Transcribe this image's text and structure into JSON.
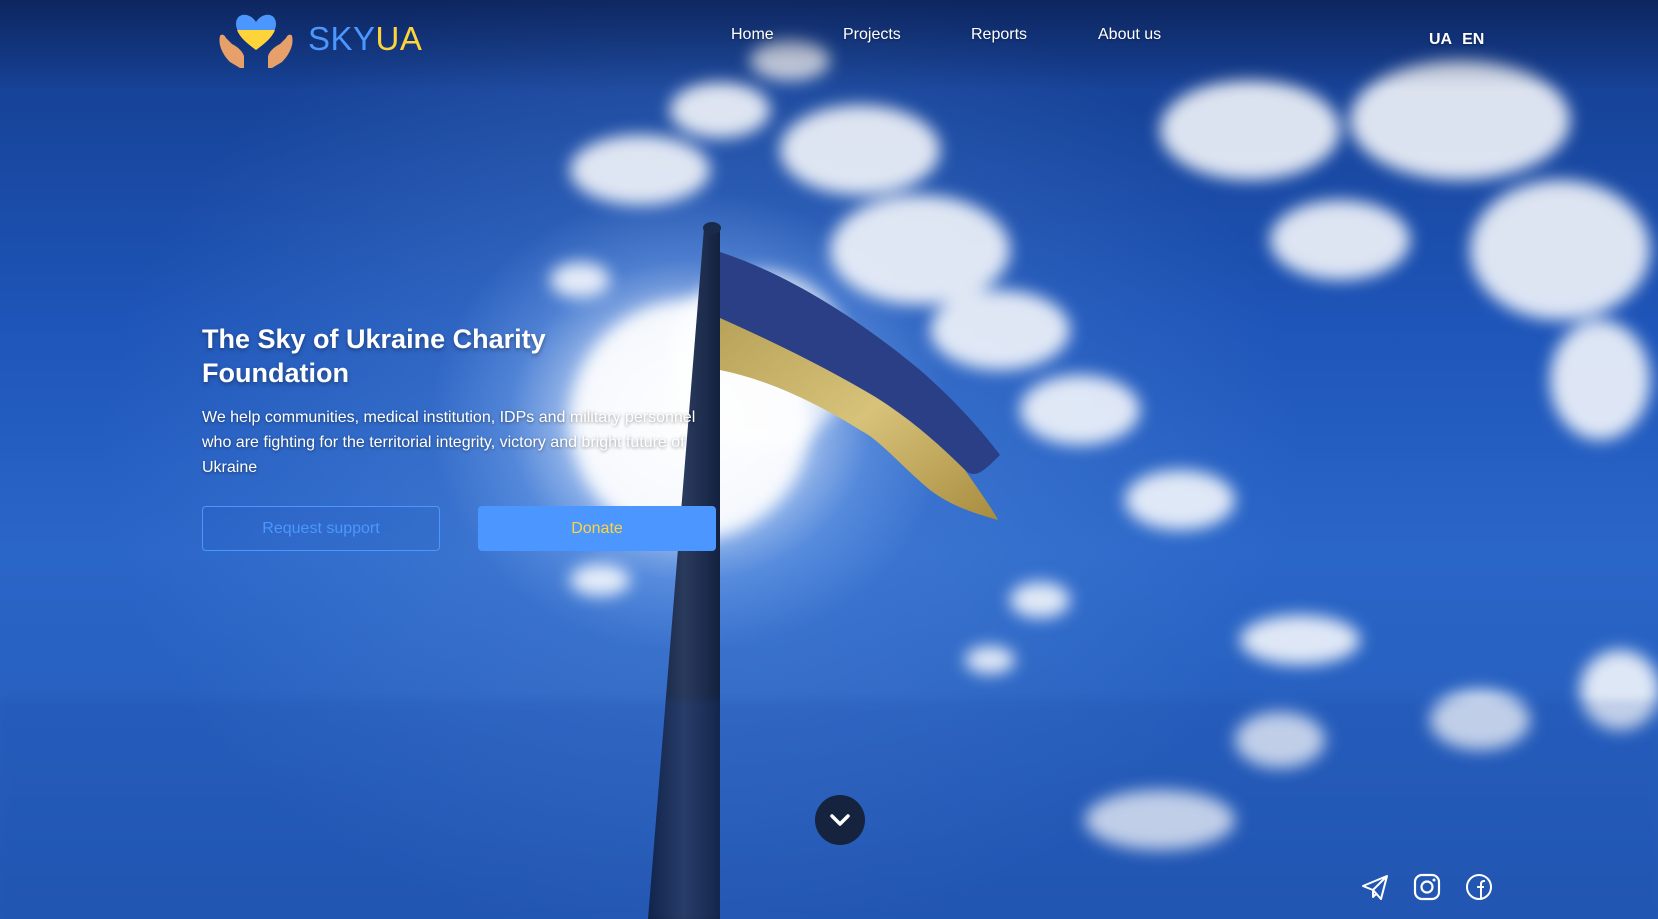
{
  "brand": {
    "name_part1": "SKY",
    "name_part2": "UA"
  },
  "nav": {
    "items": [
      "Home",
      "Projects",
      "Reports",
      "About us"
    ]
  },
  "languages": [
    "UA",
    "EN"
  ],
  "hero": {
    "title": "The Sky of Ukraine Charity Foundation",
    "subtitle": "We help communities, medical institution, IDPs and military personnel who are fighting for the territorial integrity, victory and bright future of Ukraine",
    "request_button": "Request support",
    "donate_button": "Donate"
  },
  "icons": {
    "scroll": "chevron-down-icon",
    "social": [
      "telegram-icon",
      "instagram-icon",
      "facebook-icon"
    ]
  },
  "colors": {
    "accent_blue": "#4b97ff",
    "accent_yellow": "#ffd43b",
    "scroll_button_bg": "#15233e"
  }
}
